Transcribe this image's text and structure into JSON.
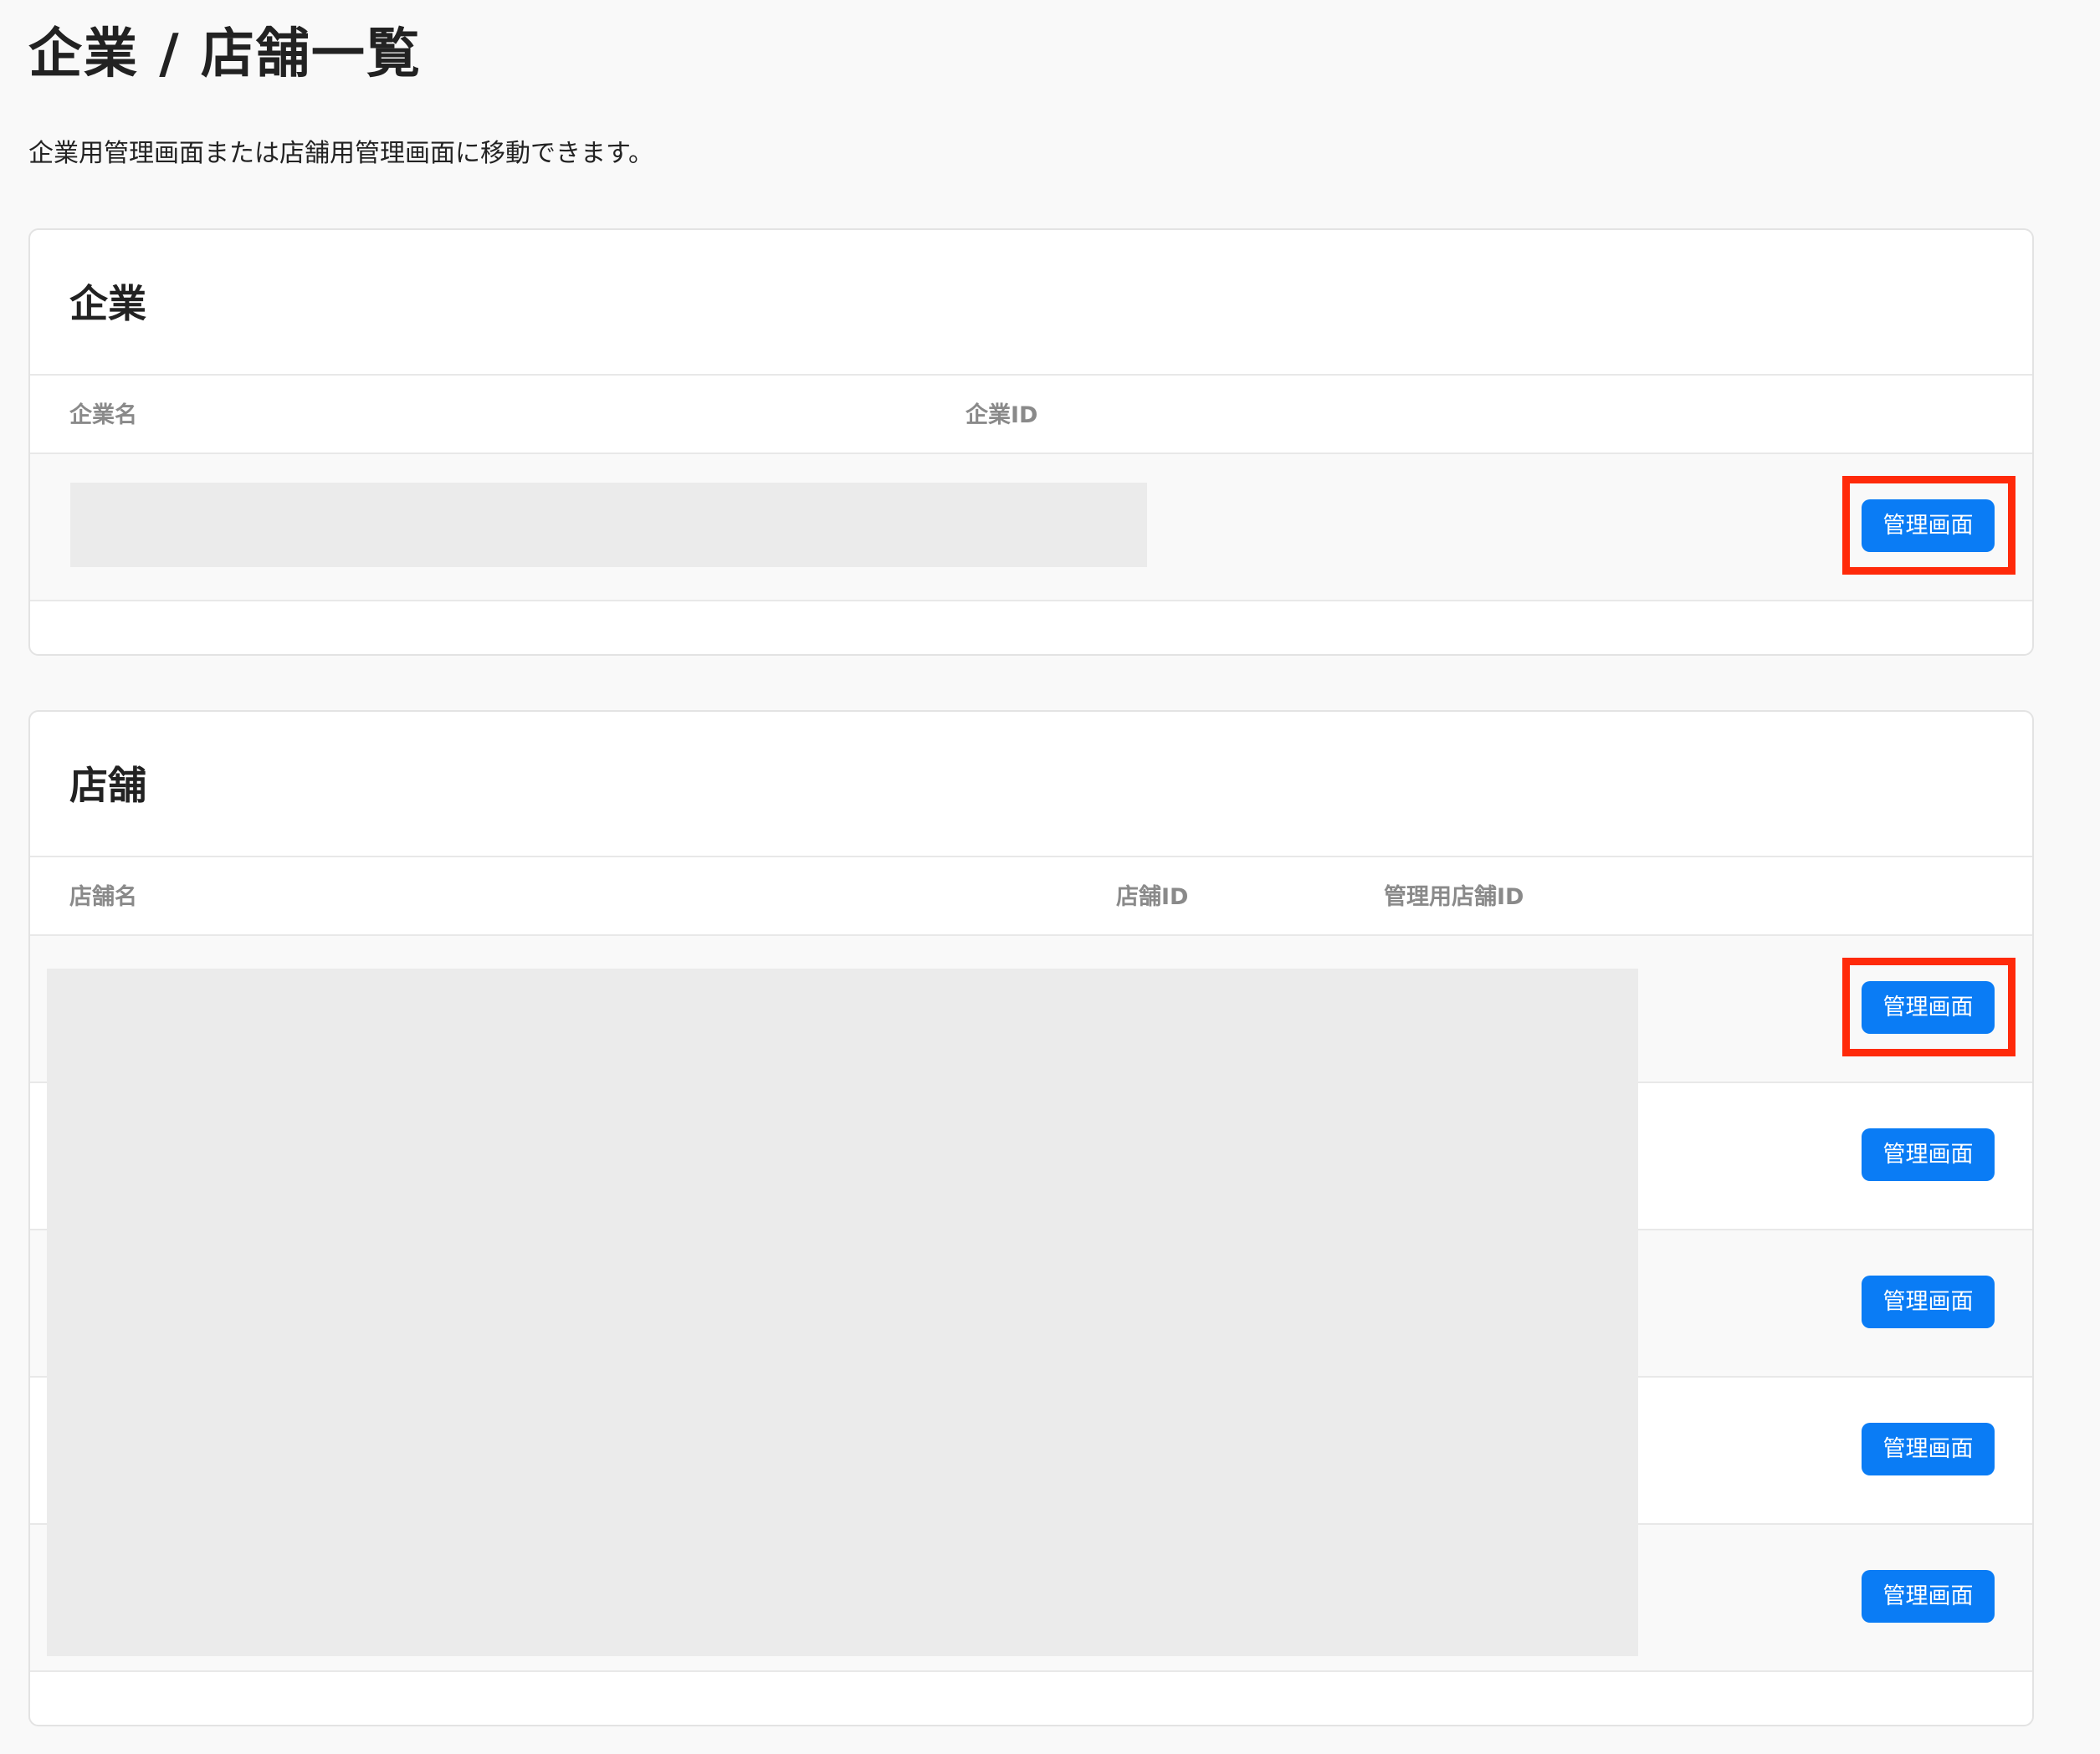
{
  "page": {
    "title": "企業 / 店舗一覧",
    "description": "企業用管理画面または店舗用管理画面に移動できます。"
  },
  "company_section": {
    "title": "企業",
    "columns": [
      "企業名",
      "企業ID"
    ],
    "rows": [
      {
        "button_label": "管理画面"
      }
    ]
  },
  "store_section": {
    "title": "店舗",
    "columns": [
      "店舗名",
      "店舗ID",
      "管理用店舗ID"
    ],
    "rows": [
      {
        "button_label": "管理画面"
      },
      {
        "button_label": "管理画面"
      },
      {
        "button_label": "管理画面"
      },
      {
        "button_label": "管理画面"
      },
      {
        "button_label": "管理画面"
      }
    ]
  },
  "colors": {
    "primary_button": "#0a7cf5",
    "highlight": "#ff2a0a",
    "redaction": "#ebebeb"
  }
}
